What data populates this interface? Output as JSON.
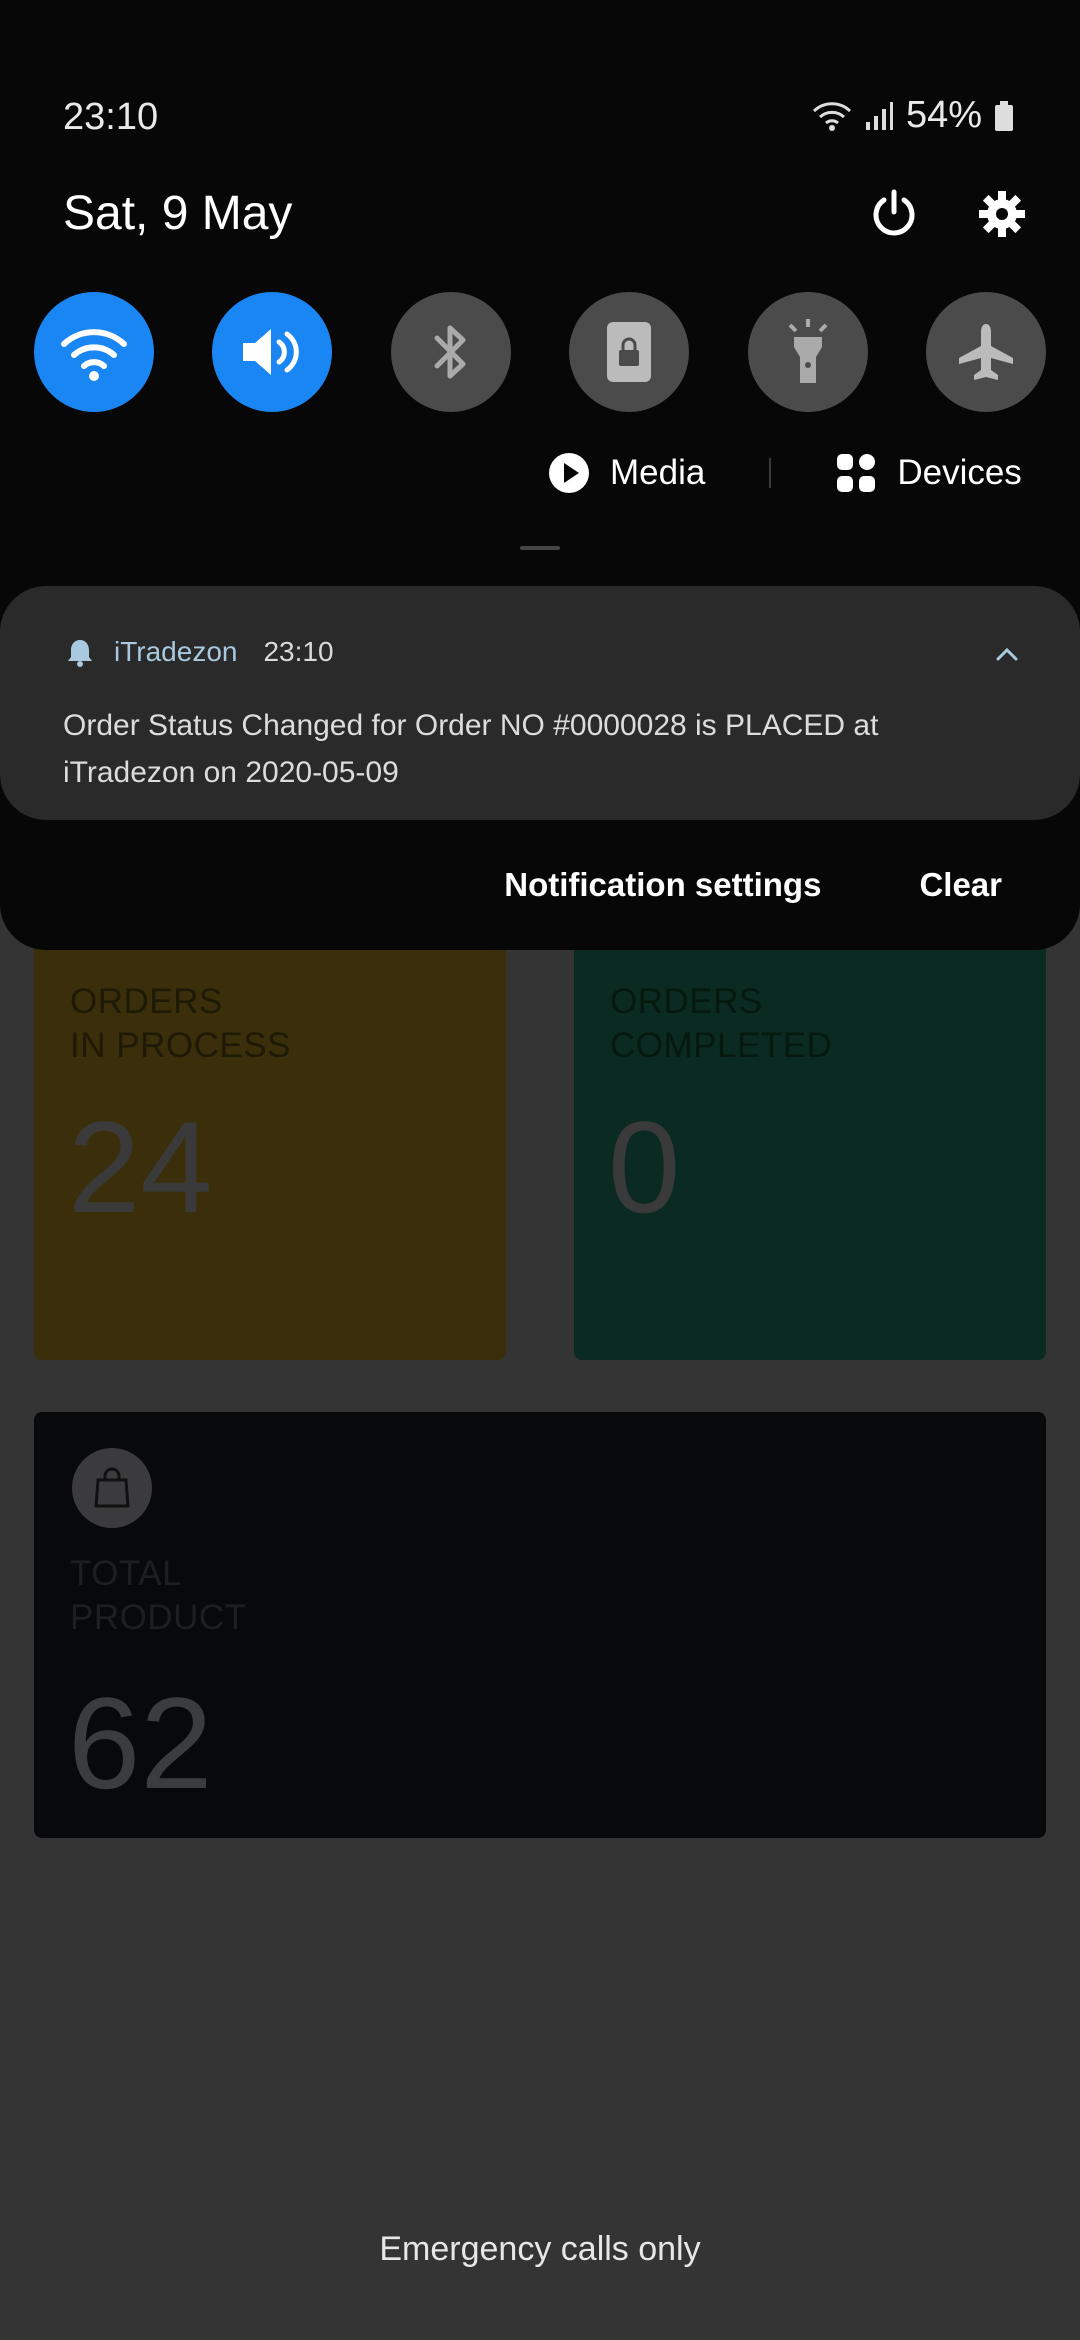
{
  "status_bar": {
    "time": "23:10",
    "battery": "54%"
  },
  "quick_panel": {
    "date": "Sat, 9 May",
    "media_label": "Media",
    "devices_label": "Devices",
    "tiles": [
      "wifi",
      "sound",
      "bluetooth",
      "screen-lock",
      "flashlight",
      "airplane"
    ]
  },
  "notification": {
    "app": "iTradezon",
    "time": "23:10",
    "text": "Order Status Changed for Order NO #0000028 is PLACED at iTradezon on 2020-05-09"
  },
  "actions": {
    "settings": "Notification settings",
    "clear": "Clear"
  },
  "dashboard": {
    "in_process": {
      "label_line1": "ORDERS",
      "label_line2": "IN PROCESS",
      "value": "24"
    },
    "completed": {
      "label_line1": "ORDERS",
      "label_line2": "COMPLETED",
      "value": "0"
    },
    "total": {
      "label_line1": "TOTAL",
      "label_line2": "PRODUCT",
      "value": "62"
    }
  },
  "footer": {
    "emergency": "Emergency calls only"
  },
  "colors": {
    "accent": "#1a86f3",
    "panel": "#070707",
    "notification": "#2a2a2a"
  }
}
